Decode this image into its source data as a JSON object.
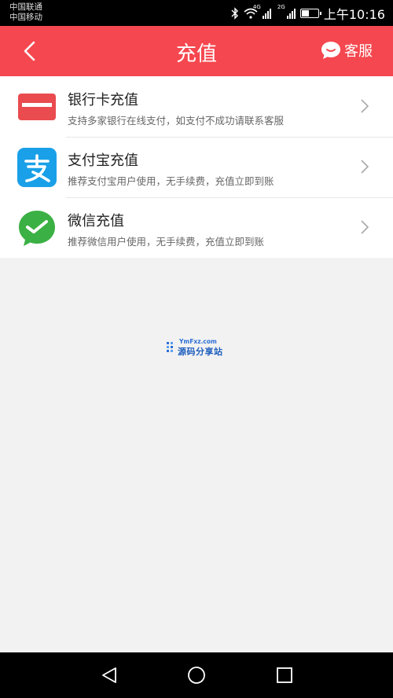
{
  "status": {
    "carrier1": "中国联通",
    "carrier2": "中国移动",
    "net1": "4G",
    "net2": "2G",
    "time": "上午10:16"
  },
  "header": {
    "title": "充值",
    "service_label": "客服"
  },
  "items": [
    {
      "name": "银行卡充值",
      "desc": "支持多家银行在线支付，如支付不成功请联系客服",
      "icon": "bank-card-icon",
      "color": "#e94b4f"
    },
    {
      "name": "支付宝充值",
      "desc": "推荐支付宝用户使用，无手续费，充值立即到账",
      "icon": "alipay-icon",
      "color": "#1aa0e8"
    },
    {
      "name": "微信充值",
      "desc": "推荐微信用户使用，无手续费，充值立即到账",
      "icon": "wechat-icon",
      "color": "#3bb044"
    }
  ],
  "watermark": {
    "top": "YmFxz.com",
    "main": "源码分享站"
  }
}
